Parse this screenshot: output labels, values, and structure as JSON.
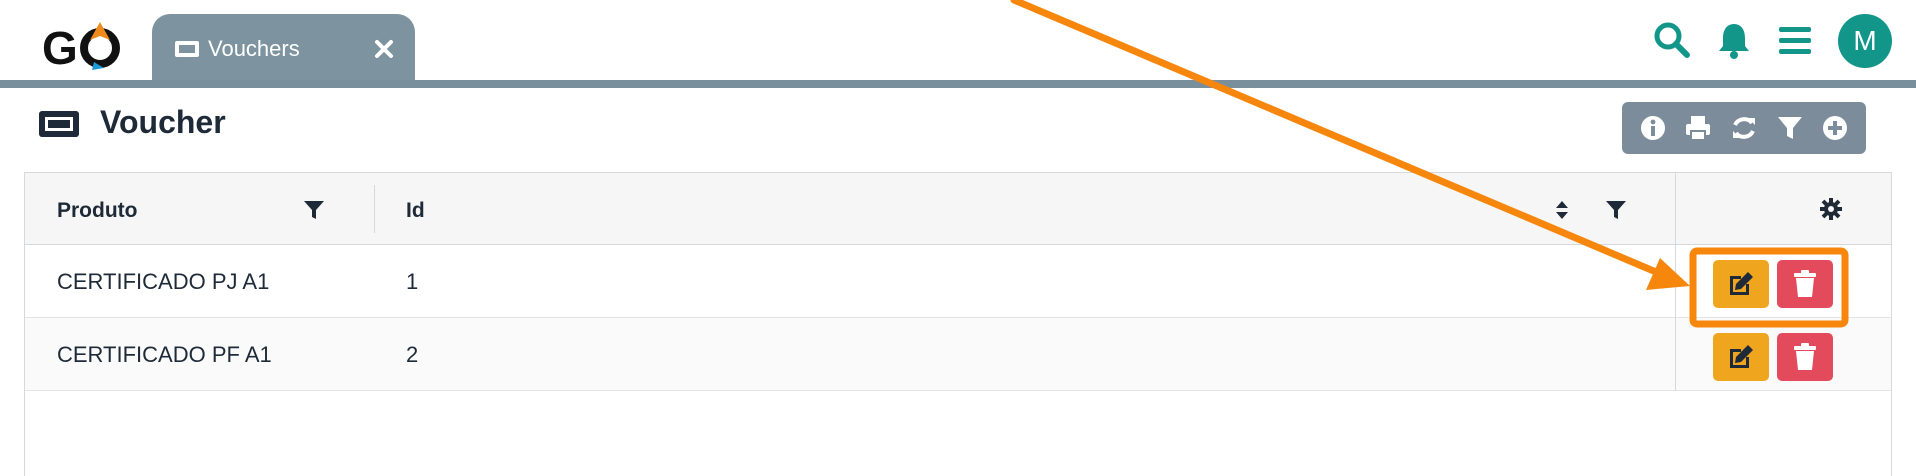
{
  "app": {
    "logo_text": "GO"
  },
  "tabs": [
    {
      "label": "Vouchers",
      "icon": "ticket-icon"
    }
  ],
  "header_icons": [
    "search-icon",
    "bell-icon",
    "menu-icon"
  ],
  "user": {
    "avatar_initial": "M"
  },
  "page": {
    "title": "Voucher",
    "icon": "ticket-icon"
  },
  "toolbar": {
    "buttons": [
      "info-icon",
      "print-icon",
      "refresh-icon",
      "filter-icon",
      "add-icon"
    ]
  },
  "grid": {
    "columns": [
      {
        "label": "Produto",
        "filterable": true
      },
      {
        "label": "Id",
        "sortable": true,
        "filterable": true
      },
      {
        "label": "",
        "icon": "gear-icon"
      }
    ],
    "rows": [
      {
        "produto": "CERTIFICADO PJ A1",
        "id": "1"
      },
      {
        "produto": "CERTIFICADO PF A1",
        "id": "2"
      }
    ]
  },
  "colors": {
    "accent": "#13968a",
    "tab": "#7d939f",
    "toolbar": "#7d8c9b",
    "edit": "#f0a51e",
    "delete": "#e34b5d",
    "annotation": "#f7860d"
  }
}
